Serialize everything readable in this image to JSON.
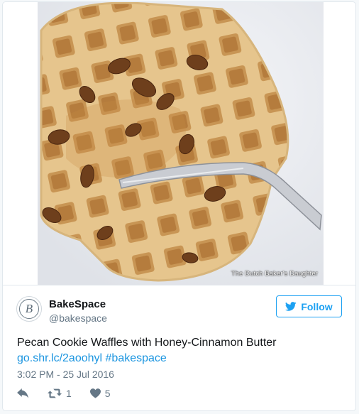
{
  "media": {
    "watermark": "The Dutch Baker's Daughter"
  },
  "author": {
    "name": "BakeSpace",
    "handle": "@bakespace",
    "avatar_letter": "B"
  },
  "follow": {
    "label": "Follow",
    "icon": "twitter-bird-icon"
  },
  "tweet": {
    "text": "Pecan Cookie Waffles with Honey-Cinnamon Butter",
    "link_url": "go.shr.lc/2aoohyl",
    "hashtag": "#bakespace",
    "timestamp": "3:02 PM - 25 Jul 2016"
  },
  "actions": {
    "reply": {
      "icon": "reply-icon"
    },
    "retweet": {
      "icon": "retweet-icon",
      "count": "1"
    },
    "like": {
      "icon": "heart-icon",
      "count": "5"
    }
  },
  "colors": {
    "accent": "#1da1f2",
    "link": "#1b95e0",
    "muted": "#657786",
    "text": "#14171a",
    "border": "#e1e8ed"
  }
}
